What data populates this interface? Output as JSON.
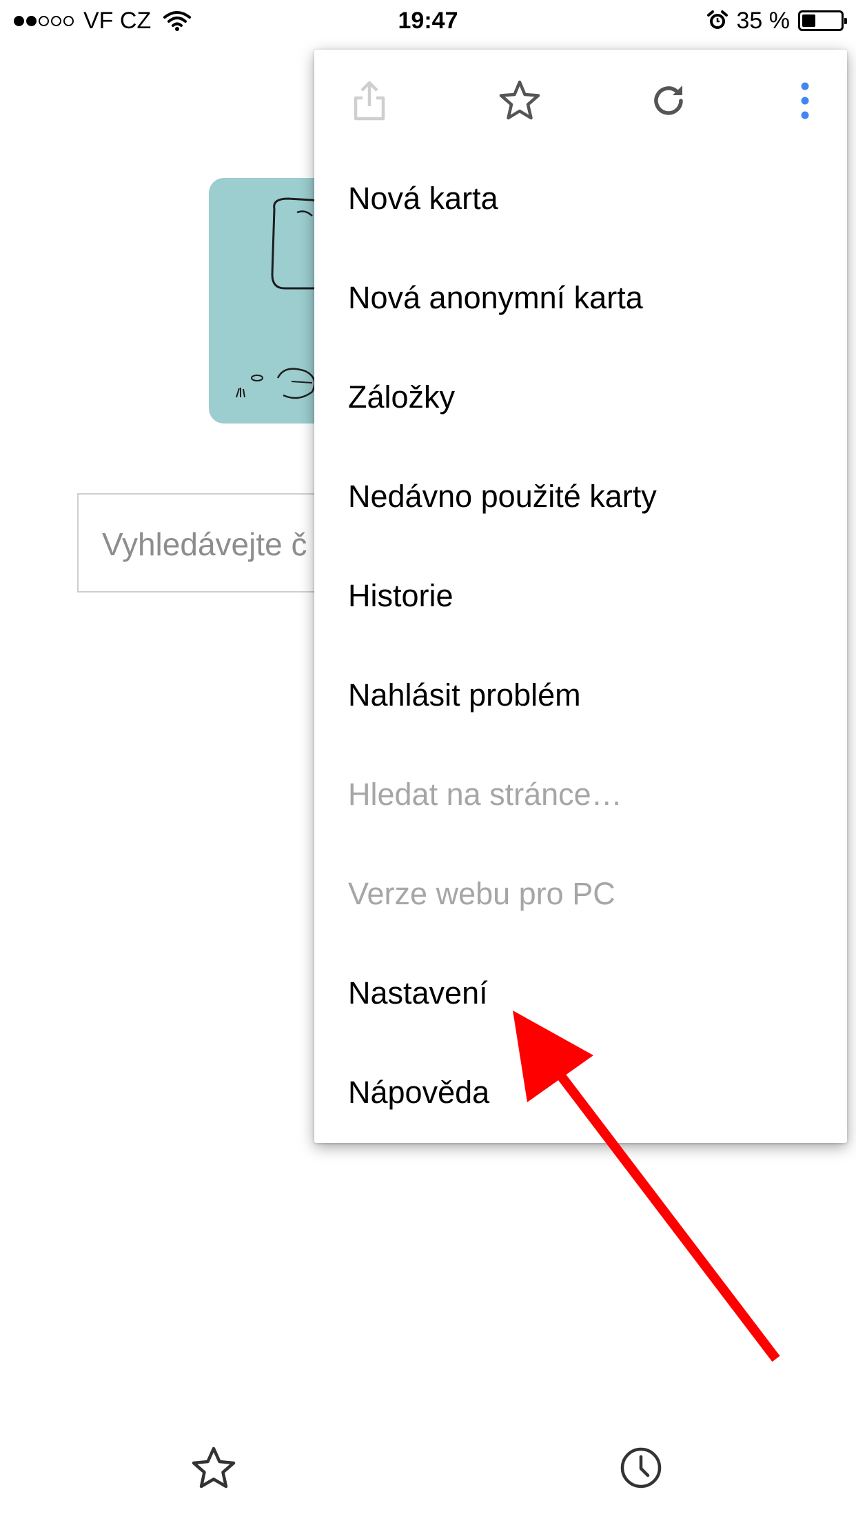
{
  "status_bar": {
    "carrier": "VF CZ",
    "signal_bars": 2,
    "signal_max": 5,
    "time": "19:47",
    "battery_percent": "35 %",
    "battery_level": 0.35
  },
  "page": {
    "search_placeholder": "Vyhledávejte č"
  },
  "menu": {
    "toolbar": {
      "share": "share-icon",
      "bookmark": "star-icon",
      "reload": "reload-icon",
      "more": "more-vertical-icon"
    },
    "items": [
      {
        "label": "Nová karta",
        "enabled": true
      },
      {
        "label": "Nová anonymní karta",
        "enabled": true
      },
      {
        "label": "Záložky",
        "enabled": true
      },
      {
        "label": "Nedávno použité karty",
        "enabled": true
      },
      {
        "label": "Historie",
        "enabled": true
      },
      {
        "label": "Nahlásit problém",
        "enabled": true
      },
      {
        "label": "Hledat na stránce…",
        "enabled": false
      },
      {
        "label": "Verze webu pro PC",
        "enabled": false
      },
      {
        "label": "Nastavení",
        "enabled": true
      },
      {
        "label": "Nápověda",
        "enabled": true
      }
    ]
  },
  "bottom_bar": {
    "left": "bookmarks-star-icon",
    "right": "history-clock-icon"
  },
  "colors": {
    "accent_blue": "#4285f4",
    "annotation_red": "#ff0000",
    "doodle_teal": "#9ccdcf",
    "disabled_text": "#a6a6a6"
  }
}
